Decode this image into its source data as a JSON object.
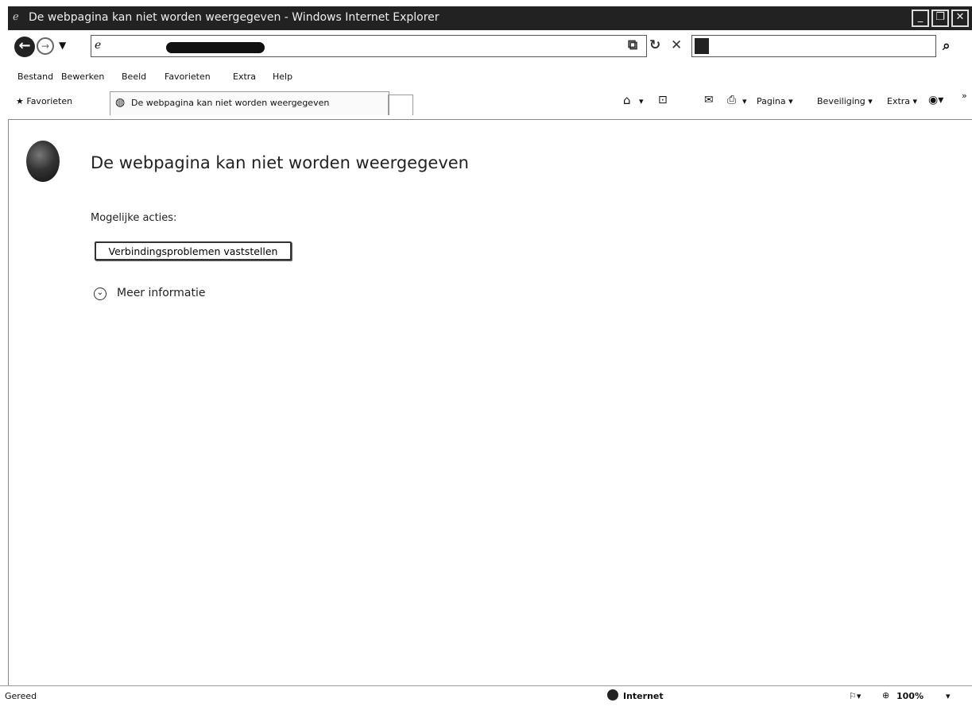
{
  "window": {
    "title": "De webpagina kan niet worden weergegeven - Windows Internet Explorer",
    "minimize": "_",
    "restore": "❐",
    "close": "✕"
  },
  "nav": {
    "back_glyph": "←",
    "forward_glyph": "→",
    "dropdown_glyph": "▼",
    "refresh_glyph": "↻",
    "stop_glyph": "✕",
    "search_go_glyph": "⌕"
  },
  "menu": {
    "items": [
      "Bestand",
      "Bewerken",
      "Beeld",
      "Favorieten",
      "Extra",
      "Help"
    ]
  },
  "favorites_bar": {
    "favorites_label": "Favorieten",
    "tab_title": "De webpagina kan niet worden weergegeven"
  },
  "command_bar": {
    "page": "Pagina",
    "safety": "Beveiliging",
    "tools": "Extra",
    "more": "»"
  },
  "content": {
    "title": "De webpagina kan niet worden weergegeven",
    "actions_label": "Mogelijke acties:",
    "diagnose_button": "Verbindingsproblemen vaststellen",
    "more_info": "Meer informatie"
  },
  "status": {
    "text": "Gereed",
    "zone": "Internet",
    "zoom": "100%"
  },
  "colors": {
    "title_bar": "#222222",
    "background": "#ffffff"
  }
}
